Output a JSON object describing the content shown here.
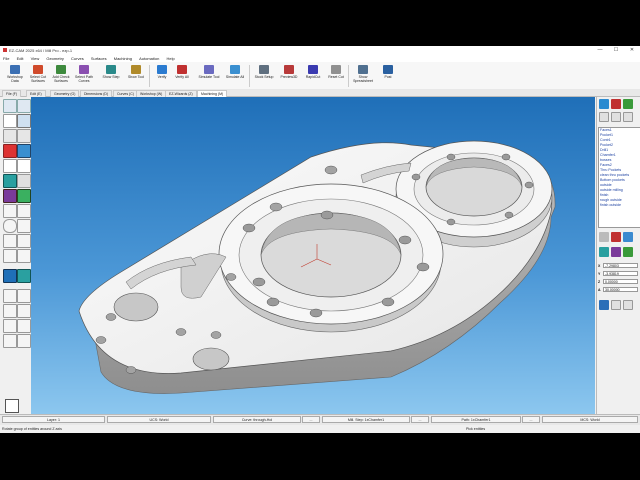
{
  "window": {
    "title": "EZ-CAM 2025 x64 / Mill Pro - ezp-1",
    "minimize": "—",
    "maximize": "☐",
    "close": "✕"
  },
  "menu": [
    "File",
    "Edit",
    "View",
    "Geometry",
    "Curves",
    "Surfaces",
    "Machining",
    "Automation",
    "Help"
  ],
  "ribbon": [
    {
      "label": "Workshop Data",
      "color": "#3b6fb3"
    },
    {
      "label": "Select Cut Surfaces",
      "color": "#d04a2b"
    },
    {
      "label": "Add Check Surfaces",
      "color": "#3d8a3d"
    },
    {
      "label": "Select Path Curves",
      "color": "#8a4fb0"
    },
    {
      "label": "Show Step",
      "color": "#2a8a8a"
    },
    {
      "label": "Show Tool",
      "color": "#b08a2a"
    },
    {
      "label": "Verify",
      "color": "#2b7bd0"
    },
    {
      "label": "Verify All",
      "color": "#c03030"
    },
    {
      "label": "Simulate Tool",
      "color": "#6a6ac0"
    },
    {
      "label": "Simulate All",
      "color": "#3a8fd0"
    },
    {
      "label": "Stock Setup",
      "color": "#5f6f7f"
    },
    {
      "label": "Preview3D",
      "color": "#b83a3a"
    },
    {
      "label": "RapidCut",
      "color": "#3a3ab0"
    },
    {
      "label": "Reset Cut",
      "color": "#909090"
    },
    {
      "label": "Show Spreadsheet",
      "color": "#507090"
    },
    {
      "label": "Post",
      "color": "#2a60a0"
    }
  ],
  "tabs": [
    "File (F)",
    "Edit (E)",
    "Geometry (G)",
    "Dimensions (D)",
    "Curves (C)",
    "Workshop (W)",
    "EZ-Wizards (Z)",
    "Machining (M)"
  ],
  "active_tab_index": 7,
  "tree_items": [
    "Faces1",
    "Pocket1",
    "Contr1",
    "Pocket2",
    "Drill1",
    "Chamfer1",
    "bosses",
    "Faces2",
    "Thru Pockets",
    "clean thru pockets",
    "Bottom pockets",
    "outside",
    "outside milling",
    "finish",
    "rough outside",
    "finish outside"
  ],
  "coords": [
    {
      "label": "X",
      "value": "-7.29803"
    },
    {
      "label": "Y",
      "value": "-3.93819"
    },
    {
      "label": "Z",
      "value": "0.00000"
    },
    {
      "label": "A",
      "value": "30.00000"
    }
  ],
  "status": {
    "layer": "Layer: 1",
    "ucs": "UCS: World",
    "curve": "Curve: through-Hol",
    "mill_step": "Mill. Step: 1xChamfer1",
    "path": "Path: 1xChamfer1",
    "mcs": "MCS: World",
    "more1": "...",
    "more2": "...",
    "more3": "..."
  },
  "hint_left": "Rotate group of entities around Z axis",
  "hint_right": "Pick entities",
  "colors": {
    "viewport_top": "#1f6fb8",
    "viewport_bottom": "#8cc7ef",
    "part": "#f2f2f2",
    "tree_text": "#1a3fa0"
  }
}
